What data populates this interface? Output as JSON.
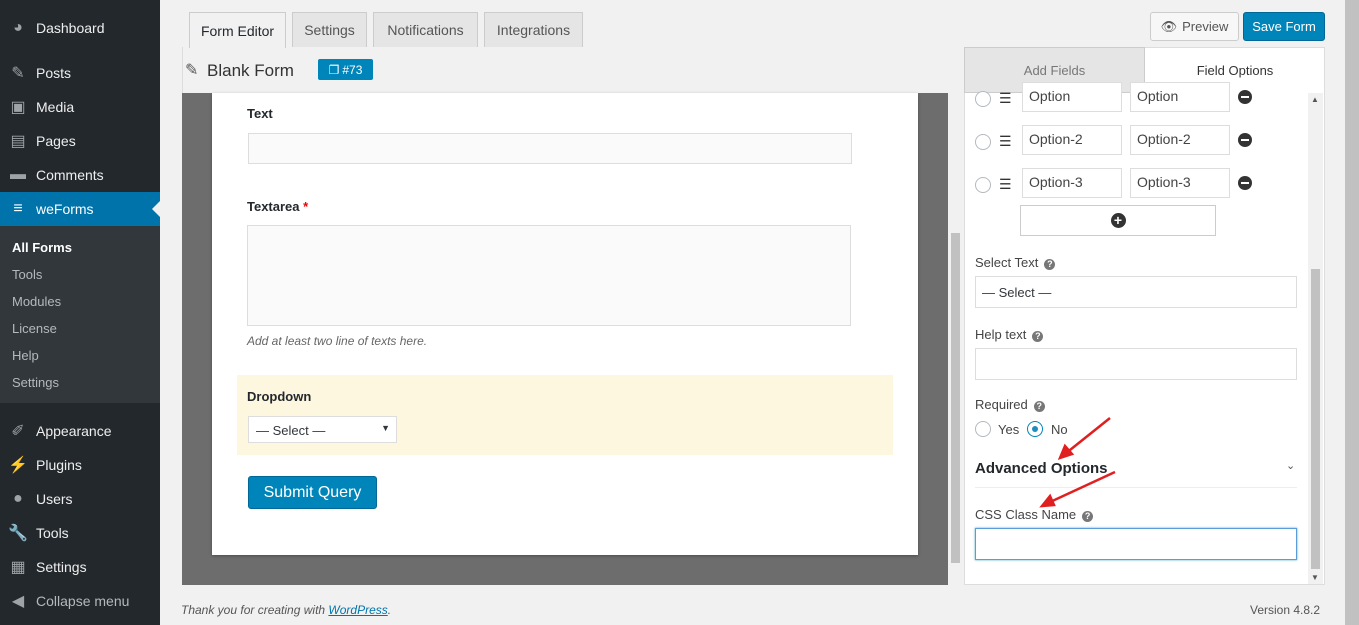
{
  "sidebar": {
    "items": [
      {
        "label": "Dashboard",
        "icon": "dashboard-icon",
        "glyph": "◕"
      },
      {
        "label": "Posts",
        "icon": "pin-icon",
        "glyph": "✎"
      },
      {
        "label": "Media",
        "icon": "media-icon",
        "glyph": "▣"
      },
      {
        "label": "Pages",
        "icon": "pages-icon",
        "glyph": "▤"
      },
      {
        "label": "Comments",
        "icon": "comments-icon",
        "glyph": "▬"
      },
      {
        "label": "weForms",
        "icon": "weforms-icon",
        "glyph": "≡"
      },
      {
        "label": "Appearance",
        "icon": "appearance-icon",
        "glyph": "✐"
      },
      {
        "label": "Plugins",
        "icon": "plugins-icon",
        "glyph": "⚡"
      },
      {
        "label": "Users",
        "icon": "users-icon",
        "glyph": "●"
      },
      {
        "label": "Tools",
        "icon": "tools-icon",
        "glyph": "🔧"
      },
      {
        "label": "Settings",
        "icon": "settings-icon",
        "glyph": "▦"
      },
      {
        "label": "Collapse menu",
        "icon": "collapse-icon",
        "glyph": "◀"
      }
    ],
    "submenu": [
      "All Forms",
      "Tools",
      "Modules",
      "License",
      "Help",
      "Settings"
    ]
  },
  "tabs": [
    "Form Editor",
    "Settings",
    "Notifications",
    "Integrations"
  ],
  "toolbar": {
    "preview": "Preview",
    "save": "Save Form"
  },
  "form": {
    "title": "Blank Form",
    "id_badge": "#73",
    "text_label": "Text",
    "textarea_label": "Textarea",
    "required_mark": "*",
    "textarea_help": "Add at least two line of texts here.",
    "dropdown_label": "Dropdown",
    "dropdown_value": "— Select —",
    "submit": "Submit Query"
  },
  "panel": {
    "tabs": [
      "Add Fields",
      "Field Options"
    ],
    "options": [
      [
        "Option",
        "Option"
      ],
      [
        "Option-2",
        "Option-2"
      ],
      [
        "Option-3",
        "Option-3"
      ]
    ],
    "select_text_label": "Select Text",
    "select_text_value": "— Select —",
    "help_text_label": "Help text",
    "required_label": "Required",
    "yes": "Yes",
    "no": "No",
    "advanced": "Advanced Options",
    "css_label": "CSS Class Name",
    "css_value": ""
  },
  "footer": {
    "thanks": "Thank you for creating with ",
    "link": "WordPress",
    "period": ".",
    "version": "Version 4.8.2"
  },
  "colors": {
    "accent": "#0085ba",
    "sidebar": "#23282d",
    "active": "#0073aa",
    "highlight": "#fef7e0",
    "annotation": "#e02020"
  }
}
